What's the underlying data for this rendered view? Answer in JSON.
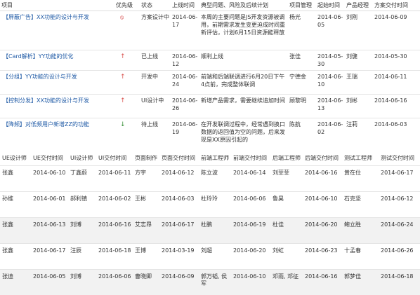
{
  "top": {
    "headers": [
      "项目",
      "优先级",
      "状态",
      "上线时间",
      "典型问题、风险及后续计划",
      "项目管理",
      "起始时间",
      "产品经理",
      "方案交付时间"
    ],
    "rows": [
      {
        "project": "【屏蔽广告】XX功能的设计与开发",
        "priority_icon": "block-icon",
        "status": "方案设计中",
        "launch": "2014-06-17",
        "issue": "本周的主要问题是JS开发资源被调用，前期需求发生变更迫成时间重新评估，计划6月15日资源能释放",
        "pm": "杨光",
        "start": "2014-06-05",
        "product": "刘刚",
        "delivery": "2014-06-09"
      },
      {
        "project": "【Card解析】YY功能的优化",
        "priority_icon": "arrow-up-icon",
        "status": "已上线",
        "launch": "2014-06-12",
        "issue": "顺利上线",
        "pm": "张佳",
        "start": "2014-05-30",
        "product": "刘健",
        "delivery": "2014-05-30"
      },
      {
        "project": "【分组】YY功能的设计与开发",
        "priority_icon": "arrow-up-icon",
        "status": "开发中",
        "launch": "2014-06-24",
        "issue": "前端和后端联调进行6月20日下午4点前，完成整体联调",
        "pm": "宁德金",
        "start": "2014-06-10",
        "product": "王瑞",
        "delivery": "2014-06-11"
      },
      {
        "project": "【控制分发】XX功能的设计与开发",
        "priority_icon": "arrow-up-icon",
        "status": "UI设计中",
        "launch": "2014-06-26",
        "issue": "新增产品需求，需要继续追加时间",
        "pm": "顾黎明",
        "start": "2014-06-13",
        "product": "刘彬",
        "delivery": "2014-06-16"
      },
      {
        "project": "【降频】对低频用户新增ZZ的功能",
        "priority_icon": "arrow-down-icon",
        "status": "待上线",
        "launch": "2014-06-19",
        "issue": "在开发联调过程中，经常遇到换口数据的返回值为空的问题，后来发现是XX原因引起的",
        "pm": "陈航",
        "start": "2014-06-02",
        "product": "汪莉",
        "delivery": "2014-06-03"
      }
    ]
  },
  "bottom": {
    "headers": [
      "UE设计师",
      "UE交付时间",
      "UI设计师",
      "UI交付时间",
      "页面制作",
      "页面交付时间",
      "前端工程师",
      "前端交付时间",
      "后端工程师",
      "后端交付时间",
      "测试工程师",
      "测试交付时间"
    ],
    "rows": [
      [
        "张鑫",
        "2014-06-10",
        "丁鑫蔚",
        "2014-06-11",
        "方宇",
        "2014-06-12",
        "陈立波",
        "2014-06-14",
        "刘菲菲",
        "2014-06-16",
        "黄在仕",
        "2014-06-17"
      ],
      [
        "孙维",
        "2014-06-01",
        "郝利镇",
        "2014-06-02",
        "王彬",
        "2014-06-03",
        "杜玲玲",
        "2014-06-06",
        "鲁昊",
        "2014-06-10",
        "石克坚",
        "2014-06-12"
      ],
      [
        "张鑫",
        "2014-06-13",
        "刘博",
        "2014-06-16",
        "艾志昂",
        "2014-06-17",
        "杜鹏",
        "2014-06-19",
        "杜佳",
        "2014-06-20",
        "鲍立胜",
        "2014-06-24"
      ],
      [
        "张鑫",
        "2014-06-17",
        "汪辰",
        "2014-06-18",
        "王博",
        "2014-03-19",
        "刘超",
        "2014-06-20",
        "刘虹",
        "2014-06-23",
        "十孟春",
        "2014-06-26"
      ],
      [
        "张迪",
        "2014-06-05",
        "刘博",
        "2014-06-06",
        "曹晓卿",
        "2014-06-09",
        "郭万韬, 侯军",
        "2014-06-10",
        "邓雨, 邓征",
        "2014-06-16",
        "郭梦佳",
        "2014-06-18"
      ]
    ]
  }
}
